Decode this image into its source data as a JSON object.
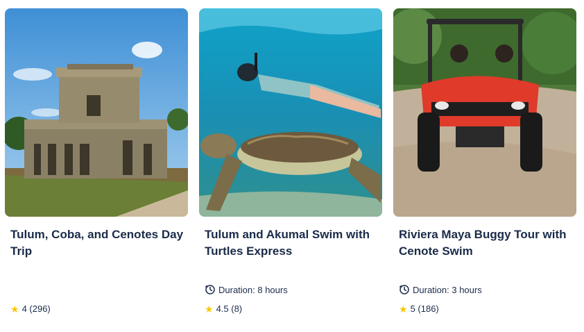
{
  "cards": [
    {
      "title": "Tulum, Coba, and Cenotes Day Trip",
      "duration": "",
      "rating": "4 (296)",
      "image": "mayan-ruins-photo"
    },
    {
      "title": "Tulum and Akumal Swim with Turtles Express",
      "duration": "Duration: 8 hours",
      "rating": "4.5 (8)",
      "image": "snorkel-turtle-photo"
    },
    {
      "title": "Riviera Maya Buggy Tour with Cenote Swim",
      "duration": "Duration: 3 hours",
      "rating": "5 (186)",
      "image": "buggy-tour-photo"
    }
  ],
  "icons": {
    "star": "star-icon",
    "clock": "clock-icon"
  },
  "colors": {
    "title": "#1a2b49",
    "star": "#fdc700"
  }
}
